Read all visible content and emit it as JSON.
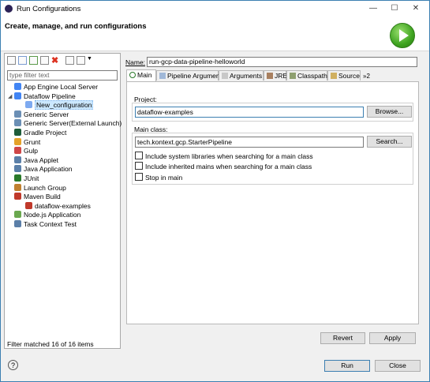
{
  "window": {
    "title": "Run Configurations",
    "controls": {
      "minimize": "—",
      "maximize": "☐",
      "close": "✕"
    }
  },
  "header": {
    "title": "Create, manage, and run configurations"
  },
  "left": {
    "filter_placeholder": "type filter text",
    "tree": [
      {
        "label": "App Engine Local Server",
        "icon": "app-engine-icon",
        "color": "#4285f4"
      },
      {
        "label": "Dataflow Pipeline",
        "icon": "dataflow-icon",
        "color": "#4285f4"
      },
      {
        "label": "New_configuration",
        "icon": "dataflow-config-icon",
        "color": "#7eaaf0"
      },
      {
        "label": "Generic Server",
        "icon": "server-icon",
        "color": "#6b8fb5"
      },
      {
        "label": "Generic Server(External Launch)",
        "icon": "server-icon",
        "color": "#6b8fb5"
      },
      {
        "label": "Gradle Project",
        "icon": "gradle-icon",
        "color": "#1e5d3a"
      },
      {
        "label": "Grunt",
        "icon": "grunt-icon",
        "color": "#e5a229"
      },
      {
        "label": "Gulp",
        "icon": "gulp-icon",
        "color": "#cf4647"
      },
      {
        "label": "Java Applet",
        "icon": "java-applet-icon",
        "color": "#5b7fa8"
      },
      {
        "label": "Java Application",
        "icon": "java-app-icon",
        "color": "#5b7fa8"
      },
      {
        "label": "JUnit",
        "icon": "junit-icon",
        "color": "#2a7a2a"
      },
      {
        "label": "Launch Group",
        "icon": "launch-group-icon",
        "color": "#c08030"
      },
      {
        "label": "Maven Build",
        "icon": "maven-icon",
        "color": "#c0392b"
      },
      {
        "label": "dataflow-examples",
        "icon": "maven-icon",
        "color": "#c0392b"
      },
      {
        "label": "Node.js Application",
        "icon": "nodejs-icon",
        "color": "#6aa84f"
      },
      {
        "label": "Task Context Test",
        "icon": "task-icon",
        "color": "#5b7fa8"
      }
    ],
    "status": "Filter matched 16 of 16 items"
  },
  "right": {
    "name_label": "Name:",
    "name_value": "run-gcp-data-pipeline-helloworld",
    "tabs": [
      {
        "label": "Main",
        "icon": "main-tab-icon"
      },
      {
        "label": "Pipeline Arguments",
        "icon": "pipeline-args-icon"
      },
      {
        "label": "Arguments",
        "icon": "arguments-icon"
      },
      {
        "label": "JRE",
        "icon": "jre-icon"
      },
      {
        "label": "Classpath",
        "icon": "classpath-icon"
      },
      {
        "label": "Source",
        "icon": "source-icon"
      }
    ],
    "tabs_more": "»2",
    "project_label": "Project:",
    "project_value": "dataflow-examples",
    "browse_label": "Browse...",
    "main_class_label": "Main class:",
    "main_class_value": "tech.kontext.gcp.StarterPipeline",
    "search_label": "Search...",
    "checkboxes": [
      {
        "label": "Include system libraries when searching for a main class",
        "checked": false
      },
      {
        "label": "Include inherited mains when searching for a main class",
        "checked": false
      },
      {
        "label": "Stop in main",
        "checked": false
      }
    ],
    "revert_label": "Revert",
    "apply_label": "Apply"
  },
  "footer": {
    "help": "?",
    "run_label": "Run",
    "close_label": "Close"
  }
}
